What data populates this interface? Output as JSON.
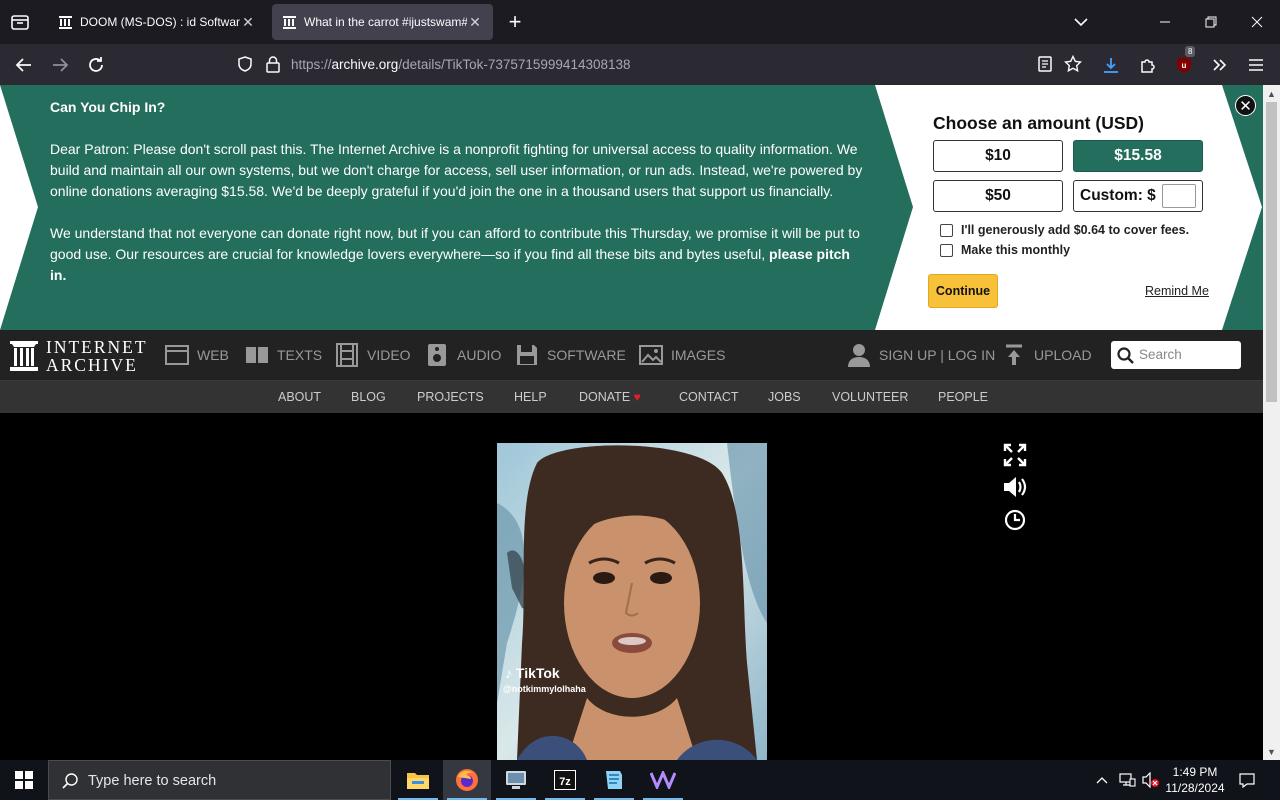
{
  "browser": {
    "tabs": [
      {
        "title": "DOOM (MS-DOS) : id Software",
        "active": false
      },
      {
        "title": "What in the carrot #ijustswam#",
        "active": true
      }
    ],
    "url_prefix": "https://",
    "url_domain": "archive.org",
    "url_path": "/details/TikTok-7375715999414308138",
    "addon_badge": "8"
  },
  "banner": {
    "heading": "Can You Chip In?",
    "paragraph1": "Dear Patron: Please don't scroll past this. The Internet Archive is a nonprofit fighting for universal access to quality information. We build and maintain all our own systems, but we don't charge for access, sell user information, or run ads. Instead, we're powered by online donations averaging $15.58. We'd be deeply grateful if you'd join the one in a thousand users that support us financially.",
    "paragraph2": "We understand that not everyone can donate right now, but if you can afford to contribute this Thursday, we promise it will be put to good use. Our resources are crucial for knowledge lovers everywhere—so if you find all these bits and bytes useful,",
    "paragraph2_bold": "please pitch in.",
    "choose_title": "Choose an amount (USD)",
    "amounts": [
      "$10",
      "$15.58",
      "$50"
    ],
    "selected_amount": "$15.58",
    "custom_label": "Custom: $",
    "custom_value": "",
    "cover_fees": "I'll generously add $0.64 to cover fees.",
    "monthly": "Make this monthly",
    "continue": "Continue",
    "remind": "Remind Me",
    "green": "#236e5c"
  },
  "ia_nav": {
    "logo_line1": "INTERNET",
    "logo_line2": "ARCHIVE",
    "items": [
      "WEB",
      "TEXTS",
      "VIDEO",
      "AUDIO",
      "SOFTWARE",
      "IMAGES"
    ],
    "signup": "SIGN UP | LOG IN",
    "upload": "UPLOAD",
    "search_placeholder": "Search"
  },
  "sub_nav": [
    "ABOUT",
    "BLOG",
    "PROJECTS",
    "HELP",
    "DONATE",
    "CONTACT",
    "JOBS",
    "VOLUNTEER",
    "PEOPLE"
  ],
  "video": {
    "watermark": "TikTok",
    "handle": "@notkimmylolhaha"
  },
  "taskbar": {
    "search_placeholder": "Type here to search",
    "time": "1:49 PM",
    "date": "11/28/2024"
  }
}
